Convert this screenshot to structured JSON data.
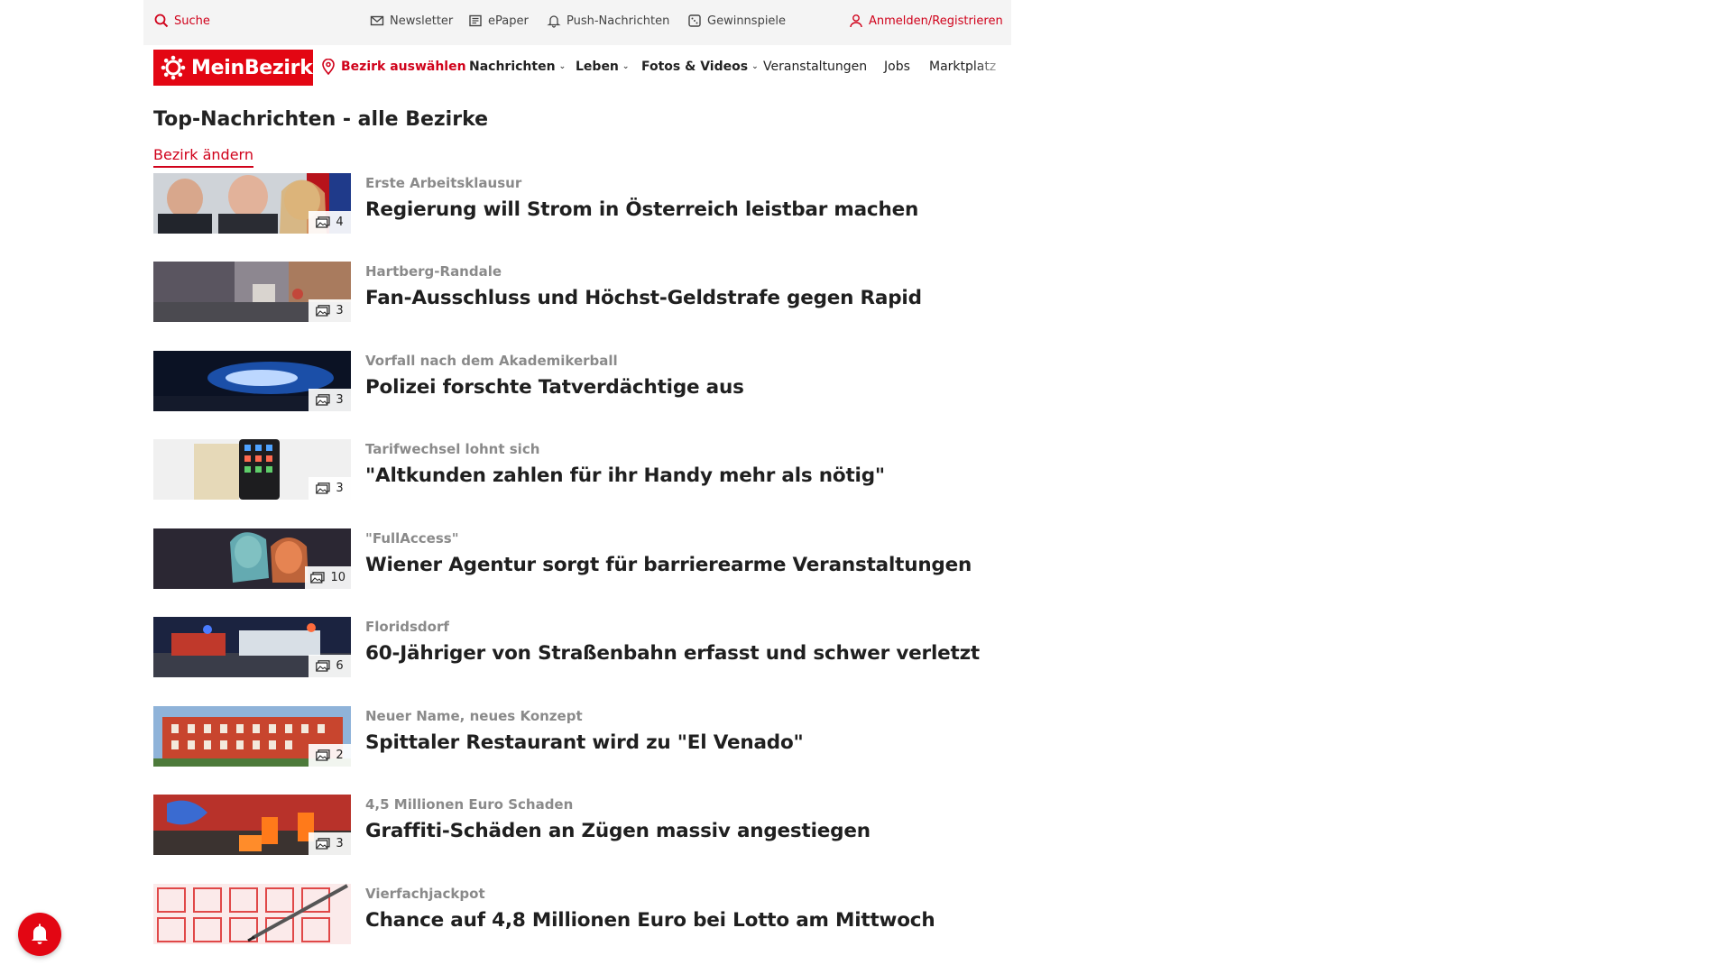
{
  "utility": {
    "search": "Suche",
    "newsletter": "Newsletter",
    "epaper": "ePaper",
    "push": "Push-Nachrichten",
    "contests": "Gewinnspiele",
    "login": "Anmelden/Registrieren"
  },
  "nav": {
    "logo": "MeinBezirk",
    "bezirk_select": "Bezirk auswählen",
    "items": [
      {
        "label": "Nachrichten",
        "dropdown": true
      },
      {
        "label": "Leben",
        "dropdown": true
      },
      {
        "label": "Fotos & Videos",
        "dropdown": true
      },
      {
        "label": "Veranstaltungen",
        "dropdown": false
      },
      {
        "label": "Jobs",
        "dropdown": false
      },
      {
        "label": "Marktplatz",
        "dropdown": false
      }
    ]
  },
  "main": {
    "title": "Top-Nachrichten - alle Bezirke",
    "change_link": "Bezirk ändern",
    "articles": [
      {
        "kicker": "Erste Arbeitsklausur",
        "headline": "Regierung will Strom in Österreich leistbar machen",
        "images": "4"
      },
      {
        "kicker": "Hartberg-Randale",
        "headline": "Fan-Ausschluss und Höchst-Geldstrafe gegen Rapid",
        "images": "3"
      },
      {
        "kicker": "Vorfall nach dem Akademikerball",
        "headline": "Polizei forschte Tatverdächtige aus",
        "images": "3"
      },
      {
        "kicker": "Tarifwechsel lohnt sich",
        "headline": "\"Altkunden zahlen für ihr Handy mehr als nötig\"",
        "images": "3"
      },
      {
        "kicker": "\"FullAccess\"",
        "headline": "Wiener Agentur sorgt für barrierearme Veranstaltungen",
        "images": "10"
      },
      {
        "kicker": "Floridsdorf",
        "headline": "60-Jähriger von Straßenbahn erfasst und schwer verletzt",
        "images": "6"
      },
      {
        "kicker": "Neuer Name, neues Konzept",
        "headline": "Spittaler Restaurant wird zu \"El Venado\"",
        "images": "2"
      },
      {
        "kicker": "4,5 Millionen Euro Schaden",
        "headline": "Graffiti-Schäden an Zügen massiv angestiegen",
        "images": "3"
      },
      {
        "kicker": "Vierfachjackpot",
        "headline": "Chance auf 4,8 Millionen Euro bei Lotto am Mittwoch",
        "images": ""
      }
    ]
  },
  "colors": {
    "brand": "#e30613",
    "accent_text": "#d0021b",
    "kicker": "#8a8a8a"
  },
  "icons": {
    "bell": "bell-icon",
    "search": "search-icon"
  }
}
